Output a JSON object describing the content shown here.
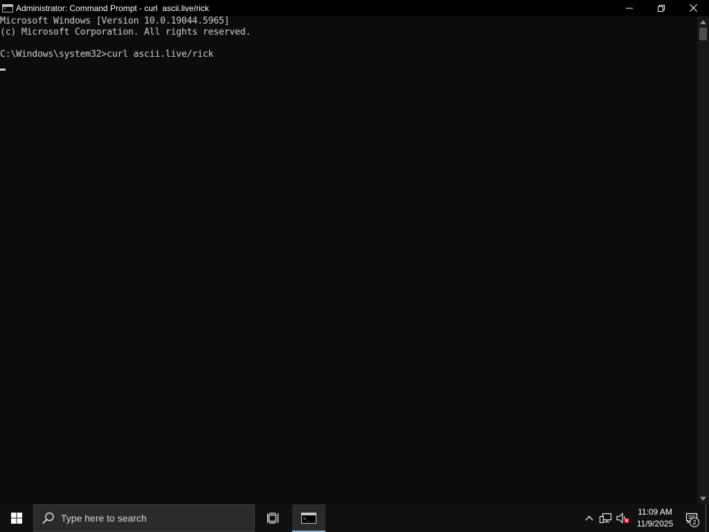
{
  "window": {
    "title": "Administrator: Command Prompt - curl  ascii.live/rick"
  },
  "console": {
    "lines": [
      "Microsoft Windows [Version 10.0.19044.5965]",
      "(c) Microsoft Corporation. All rights reserved.",
      "",
      "C:\\Windows\\system32>curl ascii.live/rick"
    ]
  },
  "taskbar": {
    "search_placeholder": "Type here to search",
    "clock_time": "11:09 AM",
    "clock_date": "11/9/2025",
    "notification_count": "2"
  },
  "colors": {
    "console_bg": "#0c0c0c",
    "console_text": "#cccccc",
    "titlebar_bg": "#000000",
    "taskbar_bg": "#101010",
    "accent": "#76b9ed"
  },
  "icons": [
    "cmd-icon",
    "minimize-icon",
    "restore-icon",
    "close-icon",
    "scroll-up-icon",
    "scroll-down-icon",
    "windows-logo-icon",
    "search-icon",
    "task-view-icon",
    "chevron-up-icon",
    "network-icon",
    "volume-muted-icon",
    "notification-icon"
  ]
}
